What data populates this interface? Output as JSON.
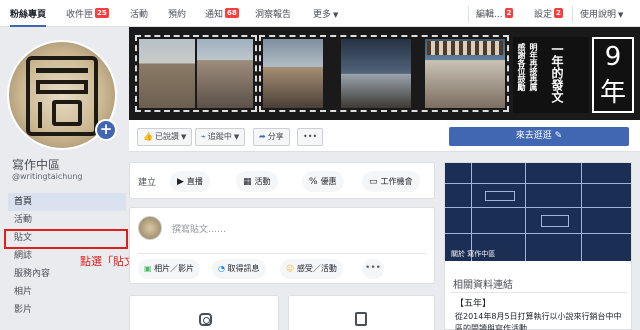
{
  "topbar": {
    "tabs": [
      {
        "label": "粉絲專頁",
        "badge": ""
      },
      {
        "label": "收件匣",
        "badge": "25"
      },
      {
        "label": "活動",
        "badge": ""
      },
      {
        "label": "預約",
        "badge": ""
      },
      {
        "label": "通知",
        "badge": "68"
      },
      {
        "label": "洞察報告",
        "badge": ""
      },
      {
        "label": "更多",
        "badge": ""
      }
    ],
    "edit": {
      "label": "編輯...",
      "badge": "2"
    },
    "settings": {
      "label": "設定",
      "badge": "2"
    },
    "help": {
      "label": "使用說明"
    }
  },
  "page": {
    "name": "寫作中區",
    "handle": "@writingtaichung"
  },
  "nav": [
    {
      "label": "首頁"
    },
    {
      "label": "活動"
    },
    {
      "label": "貼文"
    },
    {
      "label": "網誌"
    },
    {
      "label": "服務內容"
    },
    {
      "label": "相片"
    },
    {
      "label": "影片"
    }
  ],
  "callout": "點選「貼文」",
  "cover": {
    "verse_cols": [
      "感謝各位鼓勵",
      "明年再接再厲",
      "一年的發文"
    ],
    "nine": "9",
    "year": "年"
  },
  "actions": {
    "liked": "已說讚",
    "following": "追蹤中",
    "share": "分享",
    "more": "•••",
    "cta": "來去逛逛"
  },
  "create": {
    "label": "建立",
    "pills": [
      {
        "icon": "▶",
        "label": "直播"
      },
      {
        "icon": "▦",
        "label": "活動"
      },
      {
        "icon": "%",
        "label": "優惠"
      },
      {
        "icon": "▭",
        "label": "工作機會"
      }
    ]
  },
  "composer": {
    "placeholder": "撰寫貼文……",
    "photo": "相片／影片",
    "messenger": "取得訊息",
    "feeling": "感受／活動",
    "more": "•••"
  },
  "right": {
    "caption": "關於 寫作中區",
    "related": "相關資料連結",
    "five": "【五年】",
    "desc": "從2014年8月5日打算執行以小說來行銷台中中區的閱讀與寫作活動"
  },
  "colors": {
    "accent": "#4267b2",
    "badge": "#fa3e3e",
    "annotation": "#e0201b"
  }
}
